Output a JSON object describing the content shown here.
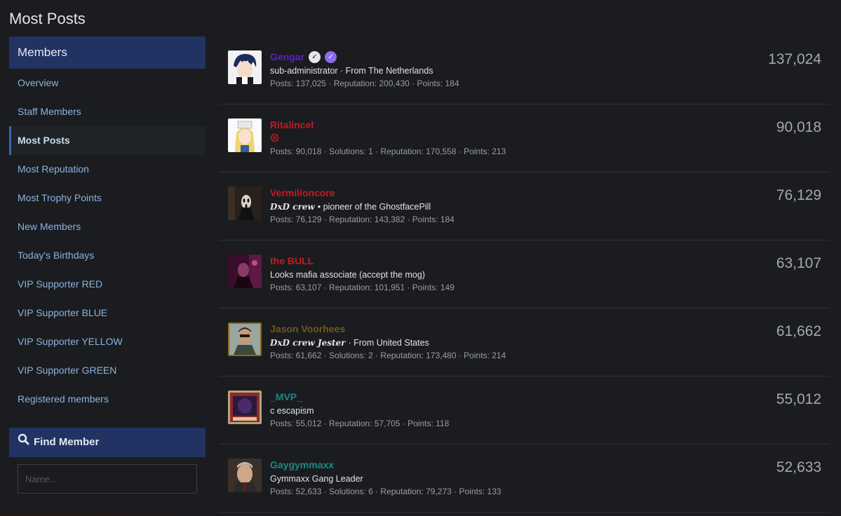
{
  "page": {
    "title": "Most Posts"
  },
  "sidebar": {
    "header": "Members",
    "items": [
      {
        "label": "Overview"
      },
      {
        "label": "Staff Members"
      },
      {
        "label": "Most Posts",
        "active": true
      },
      {
        "label": "Most Reputation"
      },
      {
        "label": "Most Trophy Points"
      },
      {
        "label": "New Members"
      },
      {
        "label": "Today's Birthdays"
      },
      {
        "label": "VIP Supporter RED"
      },
      {
        "label": "VIP Supporter BLUE"
      },
      {
        "label": "VIP Supporter YELLOW"
      },
      {
        "label": "VIP Supporter GREEN"
      },
      {
        "label": "Registered members"
      }
    ]
  },
  "find_member": {
    "header": "Find Member",
    "placeholder": "Name..."
  },
  "members": [
    {
      "name": "Gengar",
      "title": "sub-administrator · From The Netherlands",
      "stats": "Posts: 137,025 · Reputation: 200,430 · Points: 184",
      "count": "137,024",
      "name_color": "#5a1fc9"
    },
    {
      "name": "Ritalincel",
      "title": "",
      "stats": "Posts: 90,018 · Solutions: 1 · Reputation: 170,558 · Points: 213",
      "count": "90,018",
      "name_color": "#c41a24"
    },
    {
      "name": "Vermilioncore",
      "title_prefix": "DxD crew",
      "title": "• pioneer of the GhostfacePill",
      "stats": "Posts: 76,129 · Reputation: 143,382 · Points: 184",
      "count": "76,129",
      "name_color": "#c41a24"
    },
    {
      "name": "the BULL",
      "title": "Looks mafia associate (accept the mog)",
      "stats": "Posts: 63,107 · Reputation: 101,951 · Points: 149",
      "count": "63,107",
      "name_color": "#c41a24"
    },
    {
      "name": "Jason Voorhees",
      "title_prefix": "DxD crew Jester",
      "title": "· From United States",
      "stats": "Posts: 61,662 · Solutions: 2 · Reputation: 173,480 · Points: 214",
      "count": "61,662",
      "name_color": "#6b5a1c"
    },
    {
      "name": "_MVP_",
      "title": "c escapism",
      "stats": "Posts: 55,012 · Reputation: 57,705 · Points: 118",
      "count": "55,012",
      "name_color": "#1a8a86"
    },
    {
      "name": "Gaygymmaxx",
      "title": "Gymmaxx Gang Leader",
      "stats": "Posts: 52,633 · Solutions: 6 · Reputation: 79,273 · Points: 133",
      "count": "52,633",
      "name_color": "#1a8a86"
    }
  ],
  "colors": {
    "accent_header": "#213263",
    "link": "#8ab3df",
    "background": "#1b1c1f"
  }
}
